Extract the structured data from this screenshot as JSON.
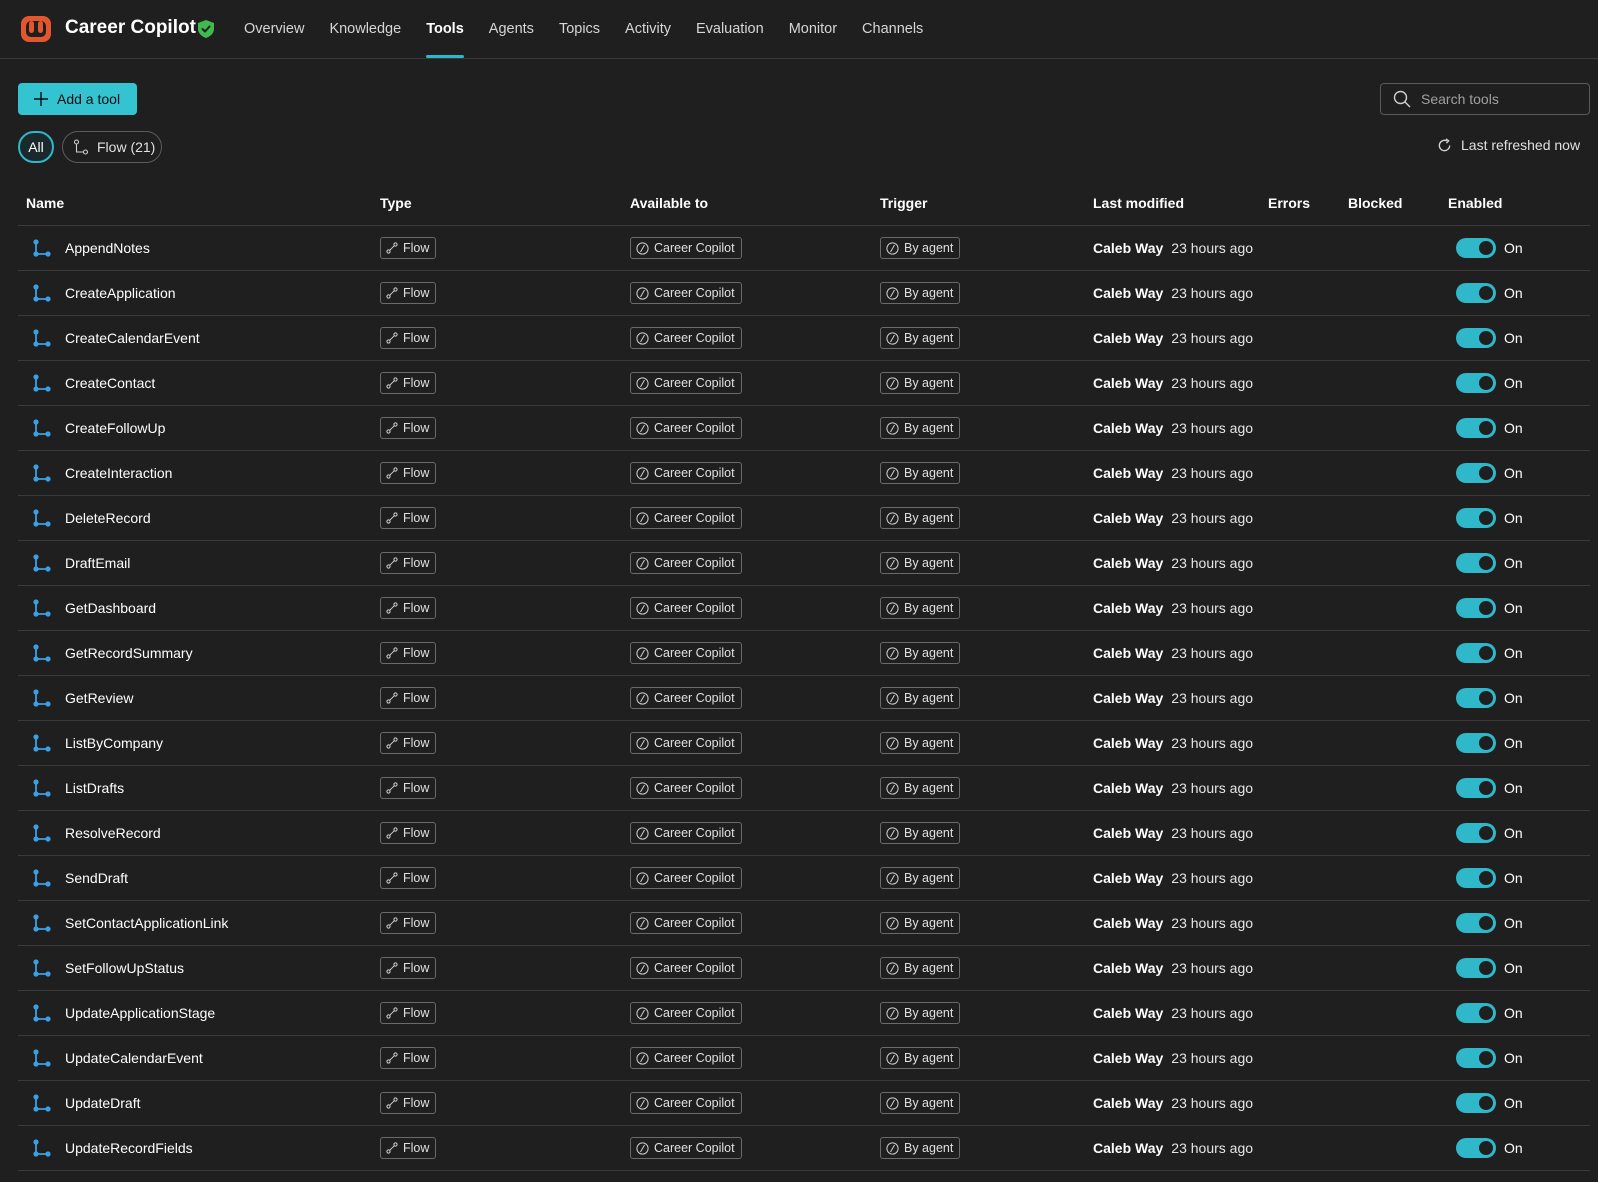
{
  "app": {
    "title": "Career Copilot"
  },
  "nav": [
    "Overview",
    "Knowledge",
    "Tools",
    "Agents",
    "Topics",
    "Activity",
    "Evaluation",
    "Monitor",
    "Channels"
  ],
  "nav_active": "Tools",
  "toolbar": {
    "add_label": "Add a tool",
    "search_placeholder": "Search tools",
    "filter_all": "All",
    "filter_flow": "Flow (21)",
    "refresh_label": "Last refreshed now"
  },
  "columns": {
    "name": "Name",
    "type": "Type",
    "available": "Available to",
    "trigger": "Trigger",
    "modified": "Last modified",
    "errors": "Errors",
    "blocked": "Blocked",
    "enabled": "Enabled"
  },
  "colors": {
    "accent": "#2fb8c9",
    "background": "#1f1f1f",
    "brand_logo": "#e4572e",
    "shield": "#3fb950"
  },
  "icons": {
    "logo": "copilot-studio-logo",
    "verified": "shield-check-icon",
    "flow": "flow-icon",
    "search": "search-icon",
    "refresh": "refresh-icon",
    "add": "plus-icon"
  },
  "rows": [
    {
      "name": "AppendNotes",
      "type": "Flow",
      "available": "Career Copilot",
      "trigger": "By agent",
      "modified_by": "Caleb Way",
      "modified_when": "23 hours ago",
      "errors": "",
      "blocked": "",
      "enabled": "On"
    },
    {
      "name": "CreateApplication",
      "type": "Flow",
      "available": "Career Copilot",
      "trigger": "By agent",
      "modified_by": "Caleb Way",
      "modified_when": "23 hours ago",
      "errors": "",
      "blocked": "",
      "enabled": "On"
    },
    {
      "name": "CreateCalendarEvent",
      "type": "Flow",
      "available": "Career Copilot",
      "trigger": "By agent",
      "modified_by": "Caleb Way",
      "modified_when": "23 hours ago",
      "errors": "",
      "blocked": "",
      "enabled": "On"
    },
    {
      "name": "CreateContact",
      "type": "Flow",
      "available": "Career Copilot",
      "trigger": "By agent",
      "modified_by": "Caleb Way",
      "modified_when": "23 hours ago",
      "errors": "",
      "blocked": "",
      "enabled": "On"
    },
    {
      "name": "CreateFollowUp",
      "type": "Flow",
      "available": "Career Copilot",
      "trigger": "By agent",
      "modified_by": "Caleb Way",
      "modified_when": "23 hours ago",
      "errors": "",
      "blocked": "",
      "enabled": "On"
    },
    {
      "name": "CreateInteraction",
      "type": "Flow",
      "available": "Career Copilot",
      "trigger": "By agent",
      "modified_by": "Caleb Way",
      "modified_when": "23 hours ago",
      "errors": "",
      "blocked": "",
      "enabled": "On"
    },
    {
      "name": "DeleteRecord",
      "type": "Flow",
      "available": "Career Copilot",
      "trigger": "By agent",
      "modified_by": "Caleb Way",
      "modified_when": "23 hours ago",
      "errors": "",
      "blocked": "",
      "enabled": "On"
    },
    {
      "name": "DraftEmail",
      "type": "Flow",
      "available": "Career Copilot",
      "trigger": "By agent",
      "modified_by": "Caleb Way",
      "modified_when": "23 hours ago",
      "errors": "",
      "blocked": "",
      "enabled": "On"
    },
    {
      "name": "GetDashboard",
      "type": "Flow",
      "available": "Career Copilot",
      "trigger": "By agent",
      "modified_by": "Caleb Way",
      "modified_when": "23 hours ago",
      "errors": "",
      "blocked": "",
      "enabled": "On"
    },
    {
      "name": "GetRecordSummary",
      "type": "Flow",
      "available": "Career Copilot",
      "trigger": "By agent",
      "modified_by": "Caleb Way",
      "modified_when": "23 hours ago",
      "errors": "",
      "blocked": "",
      "enabled": "On"
    },
    {
      "name": "GetReview",
      "type": "Flow",
      "available": "Career Copilot",
      "trigger": "By agent",
      "modified_by": "Caleb Way",
      "modified_when": "23 hours ago",
      "errors": "",
      "blocked": "",
      "enabled": "On"
    },
    {
      "name": "ListByCompany",
      "type": "Flow",
      "available": "Career Copilot",
      "trigger": "By agent",
      "modified_by": "Caleb Way",
      "modified_when": "23 hours ago",
      "errors": "",
      "blocked": "",
      "enabled": "On"
    },
    {
      "name": "ListDrafts",
      "type": "Flow",
      "available": "Career Copilot",
      "trigger": "By agent",
      "modified_by": "Caleb Way",
      "modified_when": "23 hours ago",
      "errors": "",
      "blocked": "",
      "enabled": "On"
    },
    {
      "name": "ResolveRecord",
      "type": "Flow",
      "available": "Career Copilot",
      "trigger": "By agent",
      "modified_by": "Caleb Way",
      "modified_when": "23 hours ago",
      "errors": "",
      "blocked": "",
      "enabled": "On"
    },
    {
      "name": "SendDraft",
      "type": "Flow",
      "available": "Career Copilot",
      "trigger": "By agent",
      "modified_by": "Caleb Way",
      "modified_when": "23 hours ago",
      "errors": "",
      "blocked": "",
      "enabled": "On"
    },
    {
      "name": "SetContactApplicationLink",
      "type": "Flow",
      "available": "Career Copilot",
      "trigger": "By agent",
      "modified_by": "Caleb Way",
      "modified_when": "23 hours ago",
      "errors": "",
      "blocked": "",
      "enabled": "On"
    },
    {
      "name": "SetFollowUpStatus",
      "type": "Flow",
      "available": "Career Copilot",
      "trigger": "By agent",
      "modified_by": "Caleb Way",
      "modified_when": "23 hours ago",
      "errors": "",
      "blocked": "",
      "enabled": "On"
    },
    {
      "name": "UpdateApplicationStage",
      "type": "Flow",
      "available": "Career Copilot",
      "trigger": "By agent",
      "modified_by": "Caleb Way",
      "modified_when": "23 hours ago",
      "errors": "",
      "blocked": "",
      "enabled": "On"
    },
    {
      "name": "UpdateCalendarEvent",
      "type": "Flow",
      "available": "Career Copilot",
      "trigger": "By agent",
      "modified_by": "Caleb Way",
      "modified_when": "23 hours ago",
      "errors": "",
      "blocked": "",
      "enabled": "On"
    },
    {
      "name": "UpdateDraft",
      "type": "Flow",
      "available": "Career Copilot",
      "trigger": "By agent",
      "modified_by": "Caleb Way",
      "modified_when": "23 hours ago",
      "errors": "",
      "blocked": "",
      "enabled": "On"
    },
    {
      "name": "UpdateRecordFields",
      "type": "Flow",
      "available": "Career Copilot",
      "trigger": "By agent",
      "modified_by": "Caleb Way",
      "modified_when": "23 hours ago",
      "errors": "",
      "blocked": "",
      "enabled": "On"
    }
  ]
}
